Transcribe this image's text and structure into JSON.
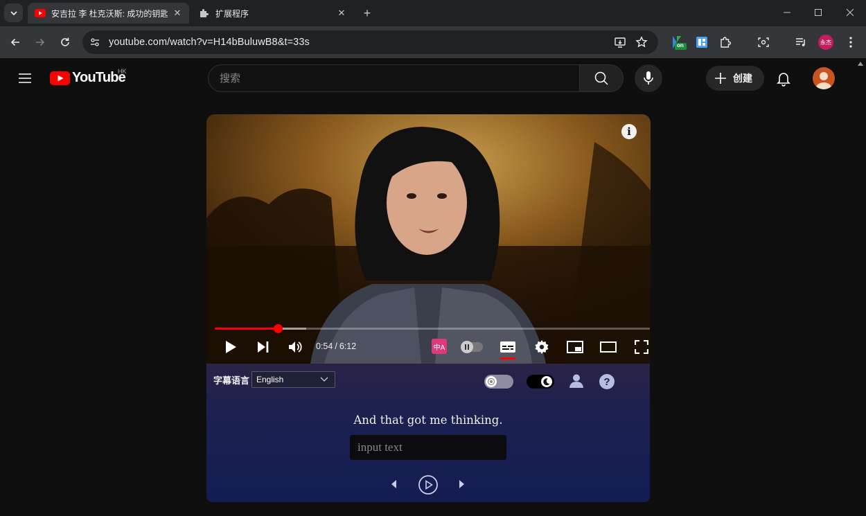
{
  "browser": {
    "tabs": [
      {
        "title": "安吉拉 李 杜克沃斯: 成功的钥匙？毅力",
        "active": true,
        "favicon": "youtube-icon"
      },
      {
        "title": "扩展程序",
        "active": false,
        "favicon": "puzzle-icon"
      }
    ],
    "url": "youtube.com/watch?v=H14bBuluwB8&t=33s",
    "profile_badge": "永杰",
    "extension_badge": "on"
  },
  "youtube": {
    "logo_text": "YouTube",
    "region": "HK",
    "search_placeholder": "搜索",
    "create_label": "创建"
  },
  "player": {
    "current_time": "0:54",
    "duration": "6:12",
    "time_separator": "/",
    "progress_played": 0.145,
    "progress_loaded": 0.21,
    "translate_badge": "中A",
    "colors": {
      "progress": "#ff0000",
      "translate": "#e0397a"
    }
  },
  "subtitle_panel": {
    "language_label": "字幕语言",
    "language_selected": "English",
    "current_subtitle": "And that got me thinking.",
    "input_placeholder": "input text",
    "help_label": "?"
  }
}
